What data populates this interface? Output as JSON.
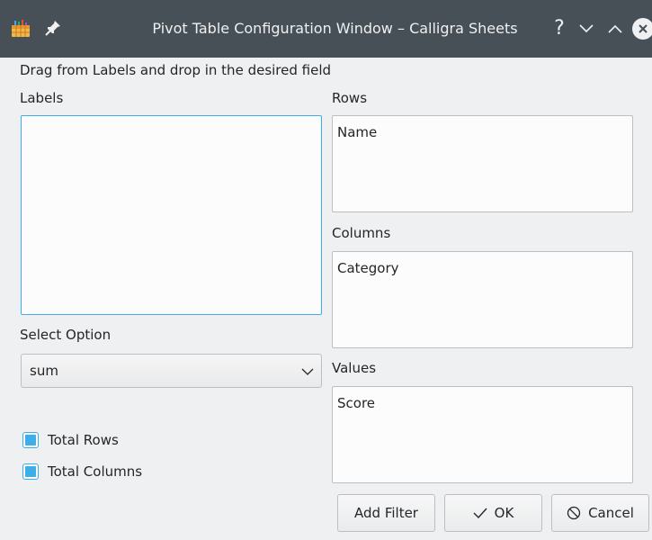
{
  "window": {
    "title": "Pivot Table Configuration Window – Calligra Sheets",
    "help_label": "?"
  },
  "hint": "Drag from Labels and drop in the desired field",
  "labels_section": {
    "title": "Labels",
    "items": []
  },
  "rows_section": {
    "title": "Rows",
    "items": [
      "Name"
    ]
  },
  "columns_section": {
    "title": "Columns",
    "items": [
      "Category"
    ]
  },
  "values_section": {
    "title": "Values",
    "items": [
      "Score"
    ]
  },
  "select_option": {
    "title": "Select Option",
    "selected": "sum"
  },
  "checkboxes": {
    "total_rows": {
      "label": "Total Rows",
      "checked": true
    },
    "total_columns": {
      "label": "Total Columns",
      "checked": true
    }
  },
  "buttons": {
    "add_filter": "Add Filter",
    "ok": "OK",
    "cancel": "Cancel"
  },
  "colors": {
    "titlebar": "#475057",
    "accent": "#3daee9",
    "background": "#eff0f1"
  }
}
